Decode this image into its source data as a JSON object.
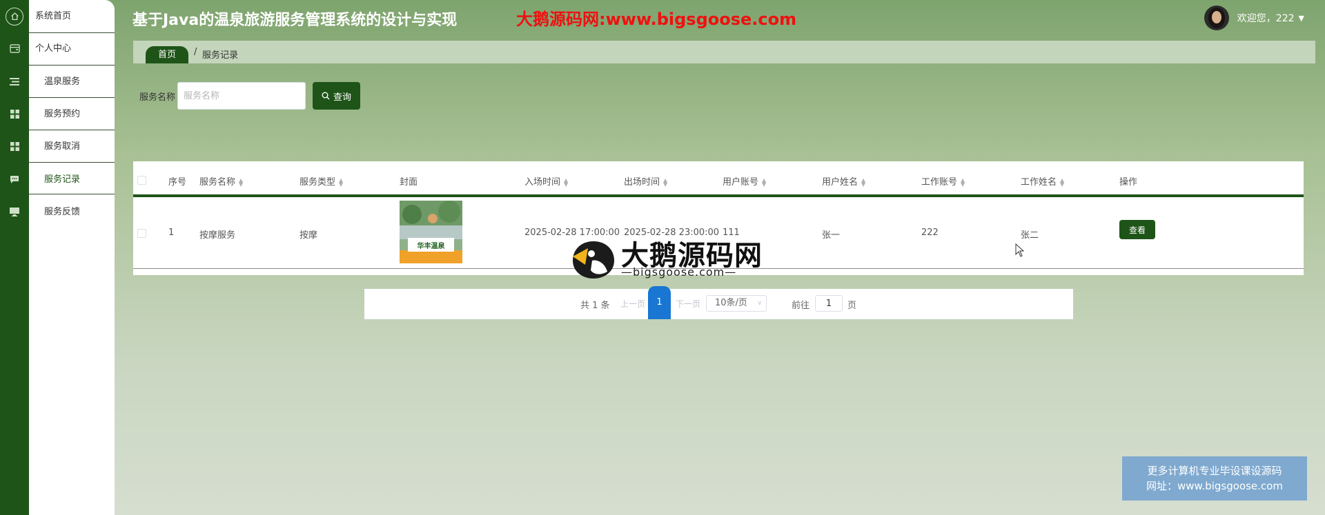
{
  "app": {
    "title": "基于Java的温泉旅游服务管理系统的设计与实现",
    "watermark_top": "大鹅源码网:www.bigsgoose.com"
  },
  "user": {
    "welcome": "欢迎您，222",
    "caret_icon": "caret-down-icon"
  },
  "sidebar": {
    "items": [
      {
        "label": "系统首页",
        "icon": "home-icon"
      },
      {
        "label": "个人中心",
        "icon": "wallet-icon"
      },
      {
        "label": "温泉服务",
        "icon": "list-icon"
      },
      {
        "label": "服务预约",
        "icon": "grid-icon"
      },
      {
        "label": "服务取消",
        "icon": "grid-icon"
      },
      {
        "label": "服务记录",
        "icon": "chat-icon"
      },
      {
        "label": "服务反馈",
        "icon": "monitor-icon"
      }
    ],
    "active": "服务记录"
  },
  "breadcrumb": {
    "home": "首页",
    "separator": "/",
    "current": "服务记录"
  },
  "search": {
    "label": "服务名称",
    "placeholder": "服务名称",
    "value": "",
    "button": "查询"
  },
  "table": {
    "columns": [
      "序号",
      "服务名称",
      "服务类型",
      "封面",
      "入场时间",
      "出场时间",
      "用户账号",
      "用户姓名",
      "工作账号",
      "工作姓名",
      "操作"
    ],
    "rows": [
      {
        "index": "1",
        "service_name": "按摩服务",
        "service_type": "按摩",
        "cover_text": "华丰温泉",
        "enter_time": "2025-02-28 17:00:00",
        "exit_time": "2025-02-28 23:00:00",
        "user_account": "111",
        "user_name": "张一",
        "work_account": "222",
        "work_name": "张二",
        "action": "查看"
      }
    ]
  },
  "pagination": {
    "total": "共 1 条",
    "prev": "上一页",
    "current": "1",
    "next": "下一页",
    "page_size": "10条/页",
    "goto_label": "前往",
    "goto_value": "1",
    "page_unit": "页"
  },
  "watermark": {
    "name": "大鹅源码网",
    "url": "—bigsgoose.com—"
  },
  "promo": {
    "line1": "更多计算机专业毕设课设源码",
    "line2": "网址：www.bigsgoose.com"
  },
  "colors": {
    "primary": "#1e5418",
    "pager_active": "#1976d2",
    "watermark_red": "#ee1111",
    "promo_bg": "#7fa9cf"
  }
}
